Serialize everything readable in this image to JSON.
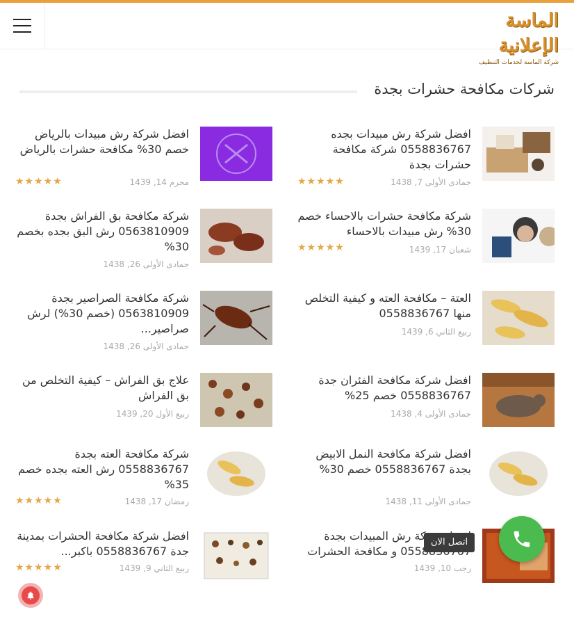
{
  "header": {
    "logo_text": "الماسة الإعلانية",
    "logo_subtext": "شركة الماسة لخدمات التنظيف"
  },
  "section": {
    "title": "شركات مكافحة حشرات بجدة"
  },
  "posts": [
    {
      "title": "افضل شركة رش مبيدات بجده 0558836767 شركة مكافحة حشرات بجدة",
      "date": "جمادى الأولى 7, 1438",
      "stars": "★★★★★"
    },
    {
      "title": "افضل شركة رش مبيدات بالرياض خصم 30% مكافحة حشرات بالرياض",
      "date": "محرم 14, 1439",
      "stars": "★★★★★"
    },
    {
      "title": "شركة مكافحة حشرات بالاحساء خصم 30% رش مبيدات بالاحساء",
      "date": "شعبان 17, 1439",
      "stars": "★★★★★"
    },
    {
      "title": "شركة مكافحة بق الفراش بجدة 0563810909 رش البق بجده بخصم 30%",
      "date": "جمادى الأولى 26, 1438",
      "stars": ""
    },
    {
      "title": "العتة – مكافحة العته و كيفية التخلص منها 0558836767",
      "date": "ربيع الثاني 6, 1439",
      "stars": ""
    },
    {
      "title": "شركة مكافحة الصراصير بجدة 0563810909 (خصم 30%) لرش صراصير...",
      "date": "جمادى الأولى 26, 1438",
      "stars": ""
    },
    {
      "title": "افضل شركة مكافحة الفئران جدة 0558836767 خصم 25%",
      "date": "جمادى الأولى 4, 1438",
      "stars": ""
    },
    {
      "title": "علاج بق الفراش – كيفية التخلص من بق الفراش",
      "date": "ربيع الأول 20, 1439",
      "stars": ""
    },
    {
      "title": "افضل شركة مكافحة النمل الابيض بجدة 0558836767 خصم 30%",
      "date": "جمادى الأولى 11, 1438",
      "stars": ""
    },
    {
      "title": "شركة مكافحة العته بجدة 0558836767 رش العته بجده خصم 35%",
      "date": "رمضان 17, 1438",
      "stars": "★★★★★"
    },
    {
      "title": "افضل شركة رش المبيدات بجدة 0558836767 و مكافحة الحشرات",
      "date": "رجب 10, 1439",
      "stars": ""
    },
    {
      "title": "افضل شركة مكافحة الحشرات بمدينة جدة 0558836767 باكبر...",
      "date": "ربيع الثاني 9, 1439",
      "stars": "★★★★★"
    }
  ],
  "call_button": {
    "label": "اتصل الان"
  },
  "colors": {
    "accent": "#e8a13d",
    "stars": "#e3a84a",
    "call": "#4cbb4f",
    "bell": "#e84a4a"
  },
  "icons": {
    "menu": "hamburger-icon",
    "call": "phone-icon",
    "notify": "bell-icon"
  }
}
